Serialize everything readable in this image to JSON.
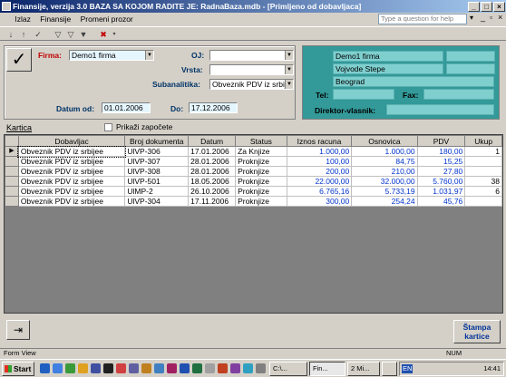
{
  "window": {
    "title": "Finansije, verzija 3.0     BAZA SA KOJOM RADITE JE: RadnaBaza.mdb - [Primljeno od dobavljaca]"
  },
  "menu": [
    "Izlaz",
    "Finansije",
    "Promeni prozor"
  ],
  "help_placeholder": "Type a question for help",
  "form": {
    "firma_label": "Firma:",
    "firma_value": "Demo1 firma",
    "oj_label": "OJ:",
    "oj_value": "",
    "vrsta_label": "Vrsta:",
    "vrsta_value": "",
    "subanalitika_label": "Subanalitika:",
    "subanalitika_value": "Obveznik PDV iz srbije",
    "datum_od_label": "Datum od:",
    "datum_od_value": "01.01.2006",
    "do_label": "Do:",
    "do_value": "17.12.2006"
  },
  "firm_info": {
    "name": "Demo1 firma",
    "street": "Vojvode Stepe",
    "city": "Beograd",
    "tel_label": "Tel:",
    "fax_label": "Fax:",
    "director_label": "Direktor-vlasnik:"
  },
  "kartica_label": "Kartica",
  "prikazi_label": "Prikaži započete",
  "grid": {
    "columns": [
      "Dobavljac",
      "Broj dokumenta",
      "Datum",
      "Status",
      "Iznos racuna",
      "Osnovica",
      "PDV",
      "Ukup"
    ],
    "rows": [
      [
        "Obveznik PDV iz srbijee",
        "UlVP-306",
        "17.01.2006",
        "Za Knjize",
        "1.000,00",
        "1.000,00",
        "180,00",
        "1"
      ],
      [
        "Obveznik PDV iz srbijee",
        "UlVP-307",
        "28.01.2006",
        "Proknjize",
        "100,00",
        "84,75",
        "15,25",
        ""
      ],
      [
        "Obveznik PDV iz srbijee",
        "UlVP-308",
        "28.01.2006",
        "Proknjize",
        "200,00",
        "210,00",
        "27,80",
        ""
      ],
      [
        "Obveznik PDV iz srbijee",
        "UlVP-501",
        "18.05.2006",
        "Proknjize",
        "22.000,00",
        "32.000,00",
        "5.760,00",
        "38"
      ],
      [
        "Obveznik PDV iz srbijee",
        "UlMP-2",
        "26.10.2006",
        "Proknjize",
        "6.765,16",
        "5.733,19",
        "1.031,97",
        "6"
      ],
      [
        "Obveznik PDV iz srbijee",
        "UlVP-304",
        "17.11.2006",
        "Proknjize",
        "300,00",
        "254,24",
        "45,76",
        ""
      ]
    ]
  },
  "print_button": "Štampa kartice",
  "status": {
    "left": "Form View",
    "num": "NUM"
  },
  "taskbar": {
    "start": "Start",
    "tasks": [
      "C:\\...",
      "Fin...",
      "2 Mi...",
      ""
    ],
    "lang": "EN",
    "clock": "14:41"
  }
}
